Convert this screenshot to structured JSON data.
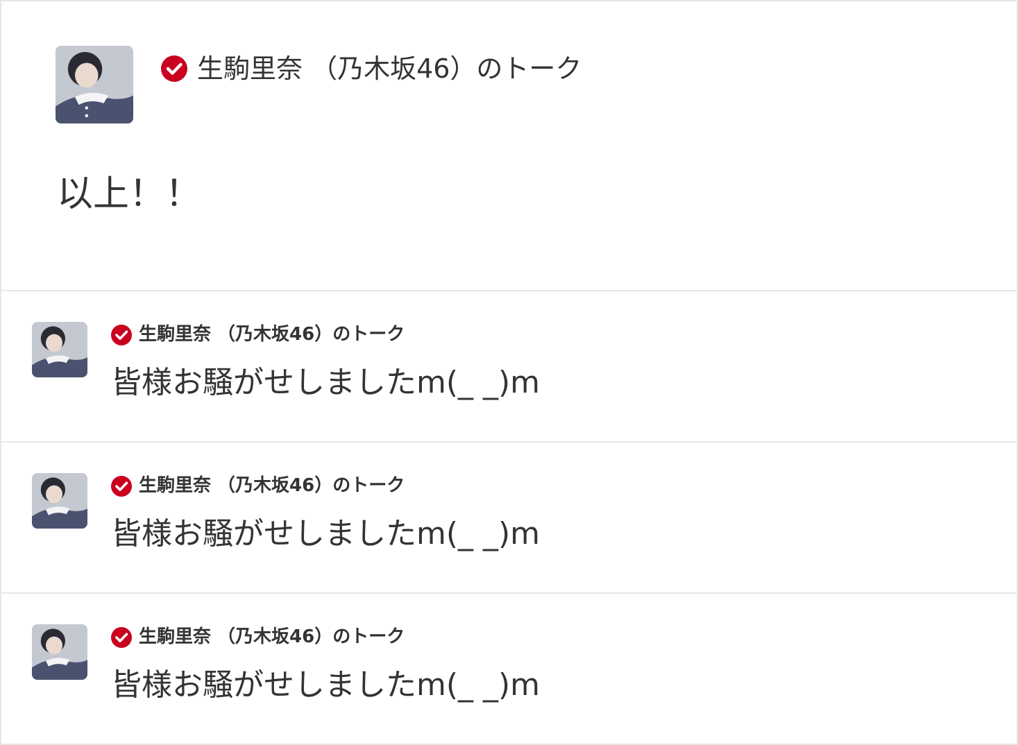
{
  "first_talk": {
    "author": "生駒里奈 （乃木坂46）のトーク",
    "message": "以上！！",
    "avatar_icon": "member-avatar",
    "badge_icon": "verified-check-icon"
  },
  "talks": [
    {
      "author": "生駒里奈 （乃木坂46）のトーク",
      "message": "皆様お騒がせしましたm(_ _)m"
    },
    {
      "author": "生駒里奈 （乃木坂46）のトーク",
      "message": "皆様お騒がせしましたm(_ _)m"
    },
    {
      "author": "生駒里奈 （乃木坂46）のトーク",
      "message": "皆様お騒がせしましたm(_ _)m"
    }
  ],
  "colors": {
    "badge": "#c9001e",
    "text": "#333333",
    "divider": "#e8e8e8"
  }
}
